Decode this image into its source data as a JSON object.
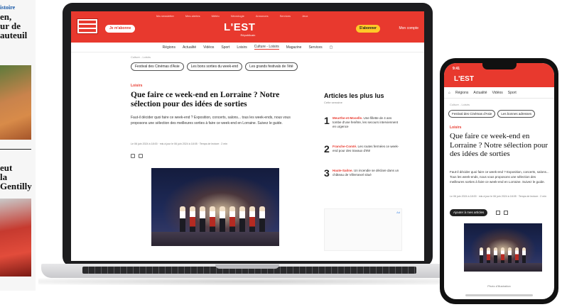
{
  "background_paper": {
    "lines": [
      "istoire",
      "en,",
      "ur de",
      "auteuil",
      "eut",
      "la",
      "Gentilly"
    ]
  },
  "site": {
    "brand": "L'EST",
    "brand_sub": "Républicain",
    "top_links": [
      "Ma newsletter",
      "Mes alertes",
      "Météo",
      "Nécrologie",
      "Annonces",
      "Services",
      "Jeux"
    ],
    "left_button": "Je m'abonne",
    "right_button": "S'abonner",
    "account": "Mon compte",
    "nav": [
      "Régions",
      "Actualité",
      "Vidéos",
      "Sport",
      "Loisirs",
      "Culture - Loisirs",
      "Magazine",
      "Services"
    ],
    "nav_active_index": 5,
    "breadcrumb": "Culture - Loisirs",
    "chips": [
      "Festival des Cinémas d'Asie",
      "Les bons sorties du week-end",
      "Les grands festivals de l'été"
    ],
    "colors": {
      "brand_red": "#e8392e",
      "accent_yellow": "#ffc928"
    }
  },
  "article": {
    "kicker": "Loisirs",
    "headline": "Que faire ce week-end en Lorraine ? Notre sélection pour des idées de sorties",
    "lede": "Faut-il décider quoi faire ce week-end ? Exposition, concerts, salons... tous les week-ends, nous vous proposons une sélection des meilleures sorties à faire ce week-end en Lorraine. Suivez le guide.",
    "meta": "Le 06 juin 2024 à 18:00 · mis à jour le 06 juin 2024 à 18:05 · Temps de lecture : 2 min",
    "photo_caption": "Photo d'illustration"
  },
  "most_read": {
    "title": "Articles les plus lus",
    "subtitle": "Cette semaine",
    "items": [
      {
        "rank": "1",
        "region": "Meurthe-et-Moselle.",
        "text": "Une fillette de 4 ans tombe d'une fenêtre, les secours interviennent en urgence"
      },
      {
        "rank": "2",
        "region": "Franche-Comté.",
        "text": "Les routes fermées ce week-end pour des travaux d'été"
      },
      {
        "rank": "3",
        "region": "Haute-Saône.",
        "text": "Un incendie se déclare dans un château de Villersexel situé"
      }
    ],
    "ad_label": "Ad"
  },
  "phone": {
    "time": "9:41",
    "brand": "L'EST",
    "nav": [
      "Régions",
      "Actualité",
      "Vidéos",
      "Sport"
    ],
    "breadcrumb": "Culture - Loisirs",
    "chips": [
      "Festival des Cinémas d'Asie",
      "Les bonnes adresses"
    ],
    "kicker": "Loisirs",
    "headline": "Que faire ce week-end en Lorraine ? Notre sélection pour des idées de sorties",
    "lede": "Faut-il décider quoi faire ce week-end ? Exposition, concerts, salons... Tous les week-ends, nous vous proposons une sélection des meilleures sorties à faire ce week-end en Lorraine. Suivez le guide.",
    "meta": "Le 06 juin 2024 à 18:00 · mis à jour le 06 juin 2024 à 18:05 · Temps de lecture : 2 min",
    "follow": "Ajouter à mes articles",
    "caption": "Photo d'illustration"
  }
}
